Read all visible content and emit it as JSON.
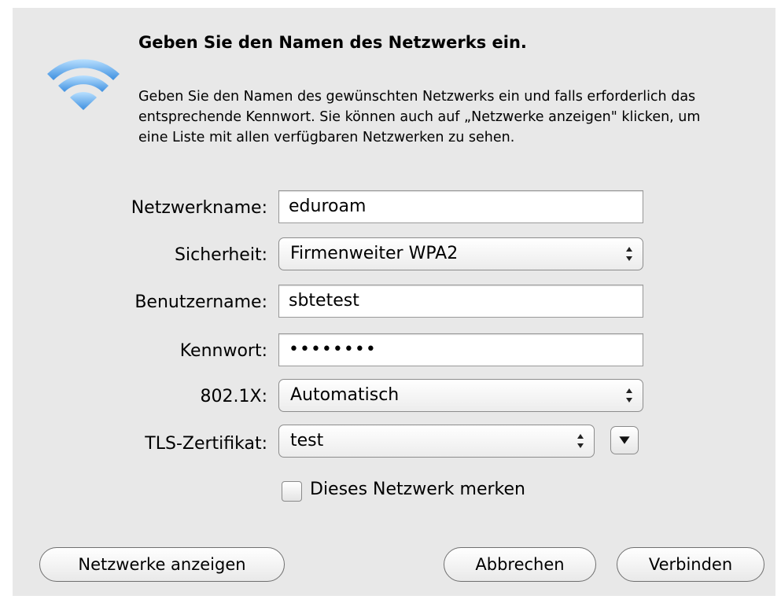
{
  "dialog": {
    "heading": "Geben Sie den Namen des Netzwerks ein.",
    "description": "Geben Sie den Namen des gewünschten Netzwerks ein und falls erforderlich das entsprechende Kennwort. Sie können auch auf „Netzwerke anzeigen\" klicken, um eine Liste mit allen verfügbaren Netzwerken zu sehen.",
    "icon": "wifi-icon",
    "accent_color": "#4aa3e8"
  },
  "form": {
    "network_name": {
      "label": "Netzwerkname:",
      "value": "eduroam"
    },
    "security": {
      "label": "Sicherheit:",
      "selected": "Firmenweiter WPA2"
    },
    "username": {
      "label": "Benutzername:",
      "value": "sbtetest"
    },
    "password": {
      "label": "Kennwort:",
      "value": "••••••••"
    },
    "dot1x": {
      "label": "802.1X:",
      "selected": "Automatisch"
    },
    "tls_certificate": {
      "label": "TLS-Zertifikat:",
      "selected": "test"
    },
    "remember": {
      "label": "Dieses Netzwerk merken",
      "checked": false
    }
  },
  "buttons": {
    "show_networks": "Netzwerke anzeigen",
    "cancel": "Abbrechen",
    "connect": "Verbinden"
  }
}
